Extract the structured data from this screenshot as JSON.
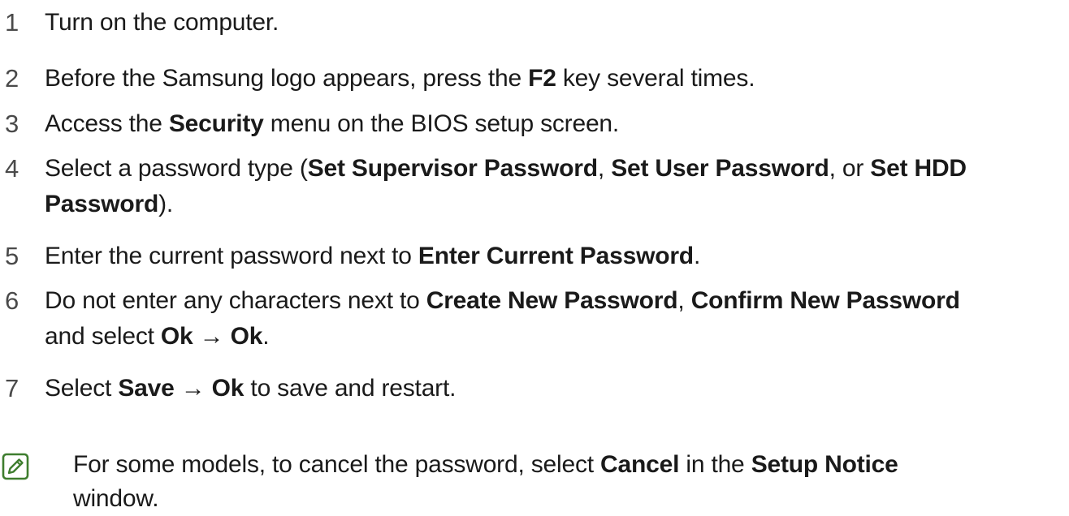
{
  "steps": [
    {
      "number": "1",
      "parts": [
        {
          "t": "Turn on the computer.",
          "b": false
        }
      ]
    },
    {
      "number": "2",
      "parts": [
        {
          "t": "Before the Samsung logo appears, press the ",
          "b": false
        },
        {
          "t": "F2",
          "b": true
        },
        {
          "t": " key several times.",
          "b": false
        }
      ]
    },
    {
      "number": "3",
      "parts": [
        {
          "t": "Access the ",
          "b": false
        },
        {
          "t": "Security",
          "b": true
        },
        {
          "t": " menu on the BIOS setup screen.",
          "b": false
        }
      ]
    },
    {
      "number": "4",
      "lines": [
        [
          {
            "t": "Select a password type (",
            "b": false
          },
          {
            "t": "Set Supervisor Password",
            "b": true
          },
          {
            "t": ", ",
            "b": false
          },
          {
            "t": "Set User Password",
            "b": true
          },
          {
            "t": ", or ",
            "b": false
          },
          {
            "t": "Set HDD",
            "b": true
          }
        ],
        [
          {
            "t": "Password",
            "b": true
          },
          {
            "t": ").",
            "b": false
          }
        ]
      ]
    },
    {
      "number": "5",
      "parts": [
        {
          "t": "Enter the current password next to ",
          "b": false
        },
        {
          "t": "Enter Current Password",
          "b": true
        },
        {
          "t": ".",
          "b": false
        }
      ]
    },
    {
      "number": "6",
      "lines": [
        [
          {
            "t": "Do not enter any characters next to ",
            "b": false
          },
          {
            "t": "Create New Password",
            "b": true
          },
          {
            "t": ", ",
            "b": false
          },
          {
            "t": "Confirm New Password",
            "b": true
          }
        ],
        [
          {
            "t": "and select ",
            "b": false
          },
          {
            "t": "Ok",
            "b": true
          },
          {
            "t": " → ",
            "b": false
          },
          {
            "t": "Ok",
            "b": true
          },
          {
            "t": ".",
            "b": false
          }
        ]
      ]
    },
    {
      "number": "7",
      "parts": [
        {
          "t": "Select ",
          "b": false
        },
        {
          "t": "Save",
          "b": true
        },
        {
          "t": " → ",
          "b": false
        },
        {
          "t": "Ok",
          "b": true
        },
        {
          "t": " to save and restart.",
          "b": false
        }
      ]
    }
  ],
  "note": {
    "icon": "note-pencil-icon",
    "icon_color": "#3e7d2e",
    "lines": [
      [
        {
          "t": "For some models, to cancel the password, select ",
          "b": false
        },
        {
          "t": "Cancel",
          "b": true
        },
        {
          "t": " in the ",
          "b": false
        },
        {
          "t": "Setup Notice",
          "b": true
        }
      ],
      [
        {
          "t": "window.",
          "b": false
        }
      ]
    ]
  }
}
